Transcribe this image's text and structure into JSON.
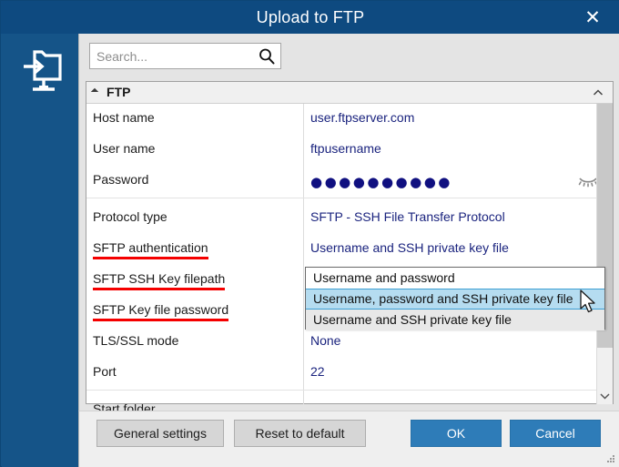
{
  "window": {
    "title": "Upload to FTP",
    "close_label": "✕",
    "titlebar_color": "#0e4a80",
    "rail_color": "#155488",
    "accent_color": "#2e7cb8",
    "underline_color": "#f50000",
    "value_color": "#1a237e"
  },
  "sidebar": {
    "icon": "monitor-upload-icon"
  },
  "search": {
    "placeholder": "Search...",
    "value": "",
    "icon": "search-icon"
  },
  "group": {
    "label": "FTP",
    "expanded": true,
    "collapse_icon": "chevron-up-icon"
  },
  "rows": [
    {
      "label": "Host name",
      "value": "user.ftpserver.com",
      "underlined": false,
      "type": "text"
    },
    {
      "label": "User name",
      "value": "ftpusername",
      "underlined": false,
      "type": "text"
    },
    {
      "label": "Password",
      "value": "●●●●●●●●●●",
      "underlined": false,
      "type": "password"
    },
    {
      "label": "Protocol type",
      "value": "SFTP - SSH File Transfer Protocol",
      "underlined": false,
      "type": "text"
    },
    {
      "label": "SFTP authentication",
      "value": "Username and SSH private key file",
      "underlined": true,
      "type": "text"
    },
    {
      "label": "SFTP SSH Key filepath",
      "value": "",
      "underlined": true,
      "type": "text"
    },
    {
      "label": "SFTP Key file password",
      "value": "",
      "underlined": true,
      "type": "text"
    },
    {
      "label": "TLS/SSL mode",
      "value": "None",
      "underlined": false,
      "type": "text"
    },
    {
      "label": "Port",
      "value": "22",
      "underlined": false,
      "type": "text"
    },
    {
      "label": "Start folder",
      "value": "",
      "underlined": false,
      "type": "text"
    }
  ],
  "password_row": {
    "reveal_icon": "eye-closed-icon"
  },
  "dropdown": {
    "open": true,
    "selected_index": 1,
    "hover_index": 2,
    "items": [
      "Username and password",
      "Username, password and SSH private key file",
      "Username and SSH private key file"
    ]
  },
  "scrollbar": {
    "down_icon": "chevron-down-icon"
  },
  "footer": {
    "general_settings": "General settings",
    "reset_to_default": "Reset to default",
    "ok": "OK",
    "cancel": "Cancel"
  },
  "cursor": {
    "icon": "arrow-pointer-icon"
  }
}
